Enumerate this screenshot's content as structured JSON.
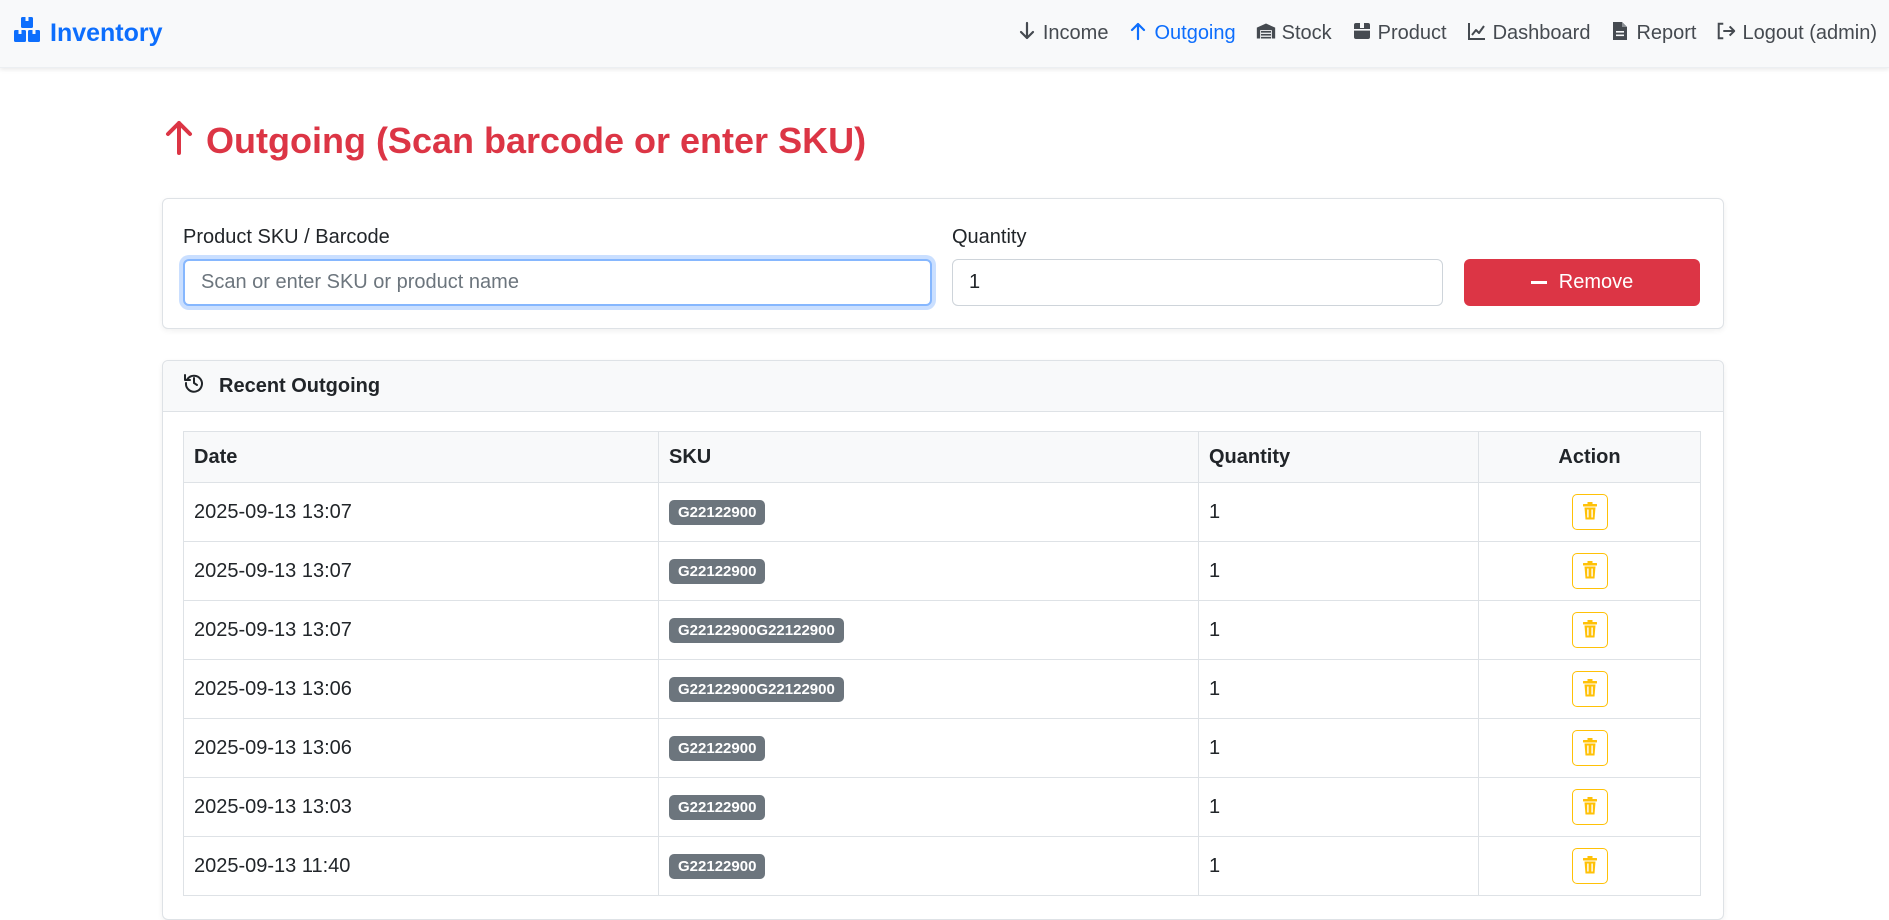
{
  "navbar": {
    "brand": "Inventory",
    "items": [
      {
        "label": "Income",
        "icon": "arrow-down-icon"
      },
      {
        "label": "Outgoing",
        "icon": "arrow-up-icon",
        "active": true
      },
      {
        "label": "Stock",
        "icon": "warehouse-icon"
      },
      {
        "label": "Product",
        "icon": "box-icon"
      },
      {
        "label": "Dashboard",
        "icon": "chart-line-icon"
      },
      {
        "label": "Report",
        "icon": "file-icon"
      },
      {
        "label": "Logout (admin)",
        "icon": "logout-icon"
      }
    ]
  },
  "colors": {
    "primary": "#0d6efd",
    "danger": "#dc3545",
    "warning": "#ffc107",
    "badge": "#6c757d"
  },
  "page": {
    "title": "Outgoing (Scan barcode or enter SKU)"
  },
  "form": {
    "sku_label": "Product SKU / Barcode",
    "sku_placeholder": "Scan or enter SKU or product name",
    "sku_value": "",
    "qty_label": "Quantity",
    "qty_value": "1",
    "remove_label": "Remove"
  },
  "recent": {
    "title": "Recent Outgoing",
    "columns": {
      "date": "Date",
      "sku": "SKU",
      "quantity": "Quantity",
      "action": "Action"
    },
    "rows": [
      {
        "date": "2025-09-13 13:07",
        "sku": "G22122900",
        "quantity": "1"
      },
      {
        "date": "2025-09-13 13:07",
        "sku": "G22122900",
        "quantity": "1"
      },
      {
        "date": "2025-09-13 13:07",
        "sku": "G22122900G22122900",
        "quantity": "1"
      },
      {
        "date": "2025-09-13 13:06",
        "sku": "G22122900G22122900",
        "quantity": "1"
      },
      {
        "date": "2025-09-13 13:06",
        "sku": "G22122900",
        "quantity": "1"
      },
      {
        "date": "2025-09-13 13:03",
        "sku": "G22122900",
        "quantity": "1"
      },
      {
        "date": "2025-09-13 11:40",
        "sku": "G22122900",
        "quantity": "1"
      }
    ]
  }
}
